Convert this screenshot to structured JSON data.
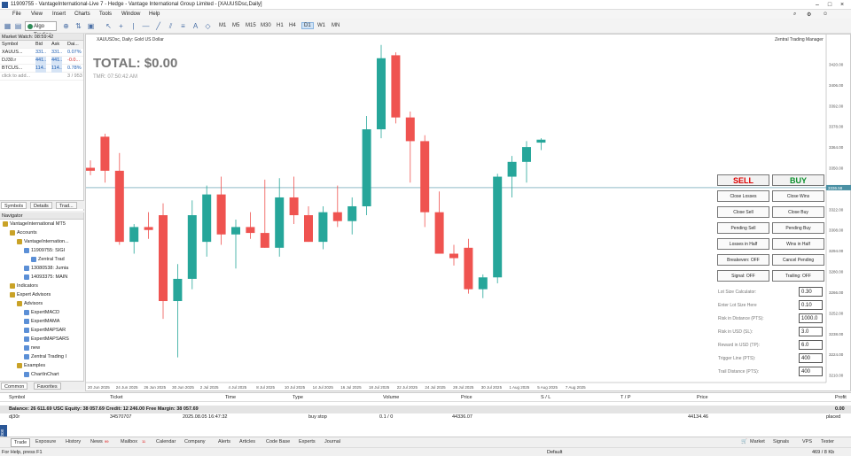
{
  "titlebar": {
    "title": "11909755 - VantageInternational-Live 7 - Hedge - Vantage International Group Limited - [XAUUSDsc,Daily]"
  },
  "menu": [
    "File",
    "View",
    "Insert",
    "Charts",
    "Tools",
    "Window",
    "Help"
  ],
  "toolbar": {
    "algo": "Algo Trading",
    "timeframes": [
      "M1",
      "M5",
      "M15",
      "M30",
      "H1",
      "H4",
      "D1",
      "W1",
      "MN"
    ],
    "active_tf": "D1"
  },
  "market_watch": {
    "title": "Market Watch: 08:59:42",
    "headers": [
      "Symbol",
      "Bid",
      "Ask",
      "Dai..."
    ],
    "rows": [
      {
        "symbol": "XAUUS...",
        "bid": "331...",
        "ask": "331...",
        "daily": "0.07%"
      },
      {
        "symbol": "DJ30.r",
        "bid": "441...",
        "ask": "441...",
        "daily": "-0.0..."
      },
      {
        "symbol": "BTCUS...",
        "bid": "114...",
        "ask": "114...",
        "daily": "0.78%"
      }
    ],
    "add_hint": "click to add...",
    "count": "3 / 953",
    "tabs": [
      "Symbols",
      "Details",
      "Trad..."
    ]
  },
  "navigator": {
    "title": "Navigator",
    "items": [
      {
        "label": "VantageInternational MT5",
        "indent": 0
      },
      {
        "label": "Accounts",
        "indent": 1
      },
      {
        "label": "VantageInternation...",
        "indent": 2
      },
      {
        "label": "11909755: SIGI",
        "indent": 3
      },
      {
        "label": "Zentral Trad",
        "indent": 4
      },
      {
        "label": "13080538: Jumia",
        "indent": 3
      },
      {
        "label": "14093375: MAIN",
        "indent": 3
      },
      {
        "label": "Indicators",
        "indent": 1
      },
      {
        "label": "Expert Advisors",
        "indent": 1
      },
      {
        "label": "Advisors",
        "indent": 2
      },
      {
        "label": "ExpertMACD",
        "indent": 3
      },
      {
        "label": "ExpertMAMA",
        "indent": 3
      },
      {
        "label": "ExpertMAPSAR",
        "indent": 3
      },
      {
        "label": "ExpertMAPSARS",
        "indent": 3
      },
      {
        "label": "new",
        "indent": 3
      },
      {
        "label": "Zentral Trading I",
        "indent": 3
      },
      {
        "label": "Examples",
        "indent": 2
      },
      {
        "label": "ChartInChart",
        "indent": 3
      }
    ],
    "tabs": [
      "Common",
      "Favorites"
    ]
  },
  "chart": {
    "title": "XAUUSDsc, Daily: Gold US Dollar",
    "total": "TOTAL: $0.00",
    "timer": "TMR: 07:50:42 AM",
    "manager": "Zentral Trading Manager",
    "price_labels": [
      "3420.00",
      "3406.00",
      "3392.00",
      "3378.00",
      "3364.00",
      "3350.00",
      "3336.00",
      "3322.00",
      "3308.00",
      "3294.00",
      "3280.00",
      "3266.00",
      "3252.00",
      "3238.00",
      "3224.00",
      "3210.00"
    ],
    "date_labels": [
      "20 Jun 2025",
      "24 Jun 2025",
      "26 Jun 2025",
      "30 Jun 2025",
      "2 Jul 2025",
      "4 Jul 2025",
      "8 Jul 2025",
      "10 Jul 2025",
      "14 Jul 2025",
      "16 Jul 2025",
      "18 Jul 2025",
      "22 Jul 2025",
      "24 Jul 2025",
      "28 Jul 2025",
      "30 Jul 2025",
      "1 Aug 2025",
      "5 Aug 2025",
      "7 Aug 2025"
    ],
    "current_price": "3336.58",
    "up_color": "#26a69a",
    "down_color": "#ef5350"
  },
  "chart_data": {
    "type": "candlestick",
    "ylim": [
      3205,
      3440
    ],
    "candles": [
      {
        "o": 3350,
        "h": 3355,
        "l": 3345,
        "c": 3348
      },
      {
        "o": 3371,
        "h": 3373,
        "l": 3340,
        "c": 3348
      },
      {
        "o": 3348,
        "h": 3360,
        "l": 3298,
        "c": 3300
      },
      {
        "o": 3300,
        "h": 3312,
        "l": 3292,
        "c": 3310
      },
      {
        "o": 3310,
        "h": 3320,
        "l": 3302,
        "c": 3308
      },
      {
        "o": 3318,
        "h": 3326,
        "l": 3248,
        "c": 3260
      },
      {
        "o": 3260,
        "h": 3285,
        "l": 3222,
        "c": 3275
      },
      {
        "o": 3275,
        "h": 3328,
        "l": 3268,
        "c": 3318
      },
      {
        "o": 3300,
        "h": 3338,
        "l": 3290,
        "c": 3332
      },
      {
        "o": 3332,
        "h": 3344,
        "l": 3298,
        "c": 3305
      },
      {
        "o": 3305,
        "h": 3315,
        "l": 3282,
        "c": 3310
      },
      {
        "o": 3310,
        "h": 3320,
        "l": 3302,
        "c": 3306
      },
      {
        "o": 3306,
        "h": 3342,
        "l": 3296,
        "c": 3296
      },
      {
        "o": 3296,
        "h": 3343,
        "l": 3290,
        "c": 3330
      },
      {
        "o": 3330,
        "h": 3344,
        "l": 3312,
        "c": 3318
      },
      {
        "o": 3318,
        "h": 3324,
        "l": 3300,
        "c": 3300
      },
      {
        "o": 3300,
        "h": 3324,
        "l": 3295,
        "c": 3320
      },
      {
        "o": 3320,
        "h": 3338,
        "l": 3310,
        "c": 3314
      },
      {
        "o": 3314,
        "h": 3330,
        "l": 3305,
        "c": 3324
      },
      {
        "o": 3324,
        "h": 3385,
        "l": 3318,
        "c": 3376
      },
      {
        "o": 3376,
        "h": 3433,
        "l": 3370,
        "c": 3424
      },
      {
        "o": 3426,
        "h": 3428,
        "l": 3380,
        "c": 3384
      },
      {
        "o": 3384,
        "h": 3388,
        "l": 3340,
        "c": 3368
      },
      {
        "o": 3368,
        "h": 3372,
        "l": 3310,
        "c": 3320
      },
      {
        "o": 3320,
        "h": 3334,
        "l": 3300,
        "c": 3292
      },
      {
        "o": 3292,
        "h": 3298,
        "l": 3284,
        "c": 3289
      },
      {
        "o": 3296,
        "h": 3302,
        "l": 3265,
        "c": 3268
      },
      {
        "o": 3268,
        "h": 3278,
        "l": 3262,
        "c": 3276
      },
      {
        "o": 3276,
        "h": 3346,
        "l": 3272,
        "c": 3344
      },
      {
        "o": 3344,
        "h": 3358,
        "l": 3330,
        "c": 3354
      },
      {
        "o": 3354,
        "h": 3368,
        "l": 3340,
        "c": 3364
      },
      {
        "o": 3367,
        "h": 3370,
        "l": 3362,
        "c": 3369
      }
    ]
  },
  "panel": {
    "sell": "SELL",
    "buy": "BUY",
    "buttons": [
      [
        "Close Losses",
        "Close Wins"
      ],
      [
        "Close Sell",
        "Close Buy"
      ],
      [
        "Pending Sell",
        "Pending Buy"
      ],
      [
        "Losses in Half",
        "Wins in Half"
      ],
      [
        "Breakeven: OFF",
        "Cancel Pending"
      ],
      [
        "Signal: OFF",
        "Trailing: OFF"
      ]
    ],
    "fields": [
      {
        "label": "Lot Size Calculator:",
        "value": "0.30"
      },
      {
        "label": "Enter Lot Size Here",
        "value": "0.10"
      },
      {
        "label": "Risk in Distance (PTS):",
        "value": "1000.0"
      },
      {
        "label": "Risk in USD (SL):",
        "value": "3.0"
      },
      {
        "label": "Reward in USD (TP):",
        "value": "6.0"
      },
      {
        "label": "Trigger Line (PTS):",
        "value": "400"
      },
      {
        "label": "Trail Distance (PTS):",
        "value": "400"
      }
    ]
  },
  "terminal": {
    "headers": [
      "Symbol",
      "Ticket",
      "Time",
      "Type",
      "Volume",
      "Price",
      "S / L",
      "T / P",
      "Price",
      "Profit"
    ],
    "balance": "Balance: 26 611.69 USC  Equity: 38 057.69  Credit: 12 246.00  Free Margin: 38 057.69",
    "balance_profit": "0.00",
    "order": {
      "symbol": "dj30r",
      "ticket": "34570707",
      "time": "2025.08.05 16:47:32",
      "type": "buy stop",
      "volume": "0.1 / 0",
      "price": "44336.07",
      "price2": "44134.46",
      "status": "placed"
    },
    "tabs": [
      "Trade",
      "Exposure",
      "History",
      "News",
      "Mailbox",
      "Calendar",
      "Company",
      "Alerts",
      "Articles",
      "Code Base",
      "Experts",
      "Journal"
    ],
    "news_badge": "99",
    "mail_badge": "11",
    "right_tabs": [
      "Market",
      "Signals",
      "VPS",
      "Tester"
    ]
  },
  "status": {
    "help": "For Help, press F1",
    "profile": "Default",
    "traffic": "469 / 8 Kb",
    "toolbox": "Toolbox"
  }
}
